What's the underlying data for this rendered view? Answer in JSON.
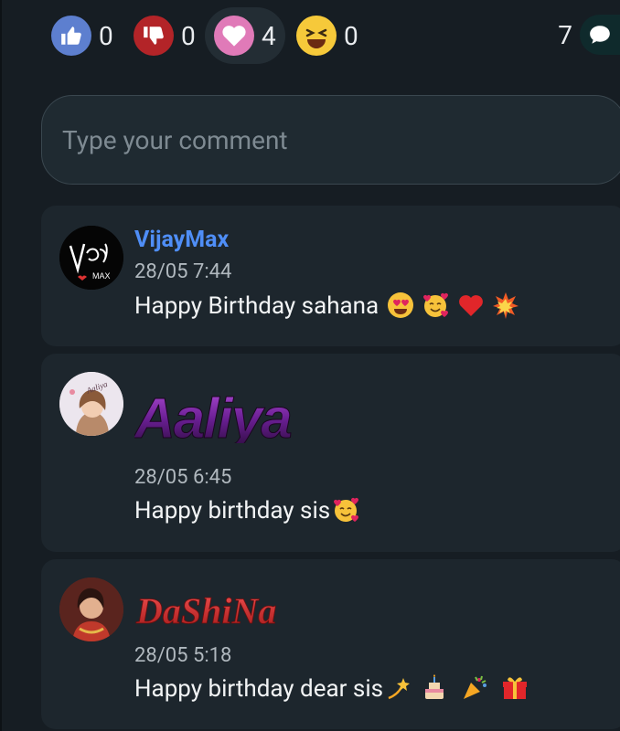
{
  "reactions": {
    "like": {
      "icon": "thumbs-up-icon",
      "count": "0"
    },
    "dislike": {
      "icon": "thumbs-down-icon",
      "count": "0"
    },
    "love": {
      "icon": "heart-icon",
      "count": "4"
    },
    "laugh": {
      "icon": "laughing-face-icon",
      "count": "0"
    },
    "comments": {
      "icon": "speech-bubble-icon",
      "count": "7"
    }
  },
  "comment_input": {
    "placeholder": "Type your comment"
  },
  "comments": [
    {
      "username": "VijayMax",
      "username_color": "#4f8ef7",
      "time": "28/05 7:44",
      "text": "Happy Birthday sahana",
      "emojis": [
        "heart-eyes",
        "smiling-face-with-hearts",
        "red-heart",
        "collision"
      ]
    },
    {
      "username": "Aaliya",
      "username_style": "decorative-purple-logo",
      "time": "28/05 6:45",
      "text": "Happy birthday sis",
      "emojis": [
        "smiling-face-with-hearts"
      ]
    },
    {
      "username": "DaShiNa",
      "username_style": "decorative-red-script",
      "time": "28/05 5:18",
      "text": "Happy birthday dear sis",
      "emojis": [
        "dizzy",
        "birthday-cake",
        "party-popper",
        "wrapped-gift"
      ]
    }
  ]
}
